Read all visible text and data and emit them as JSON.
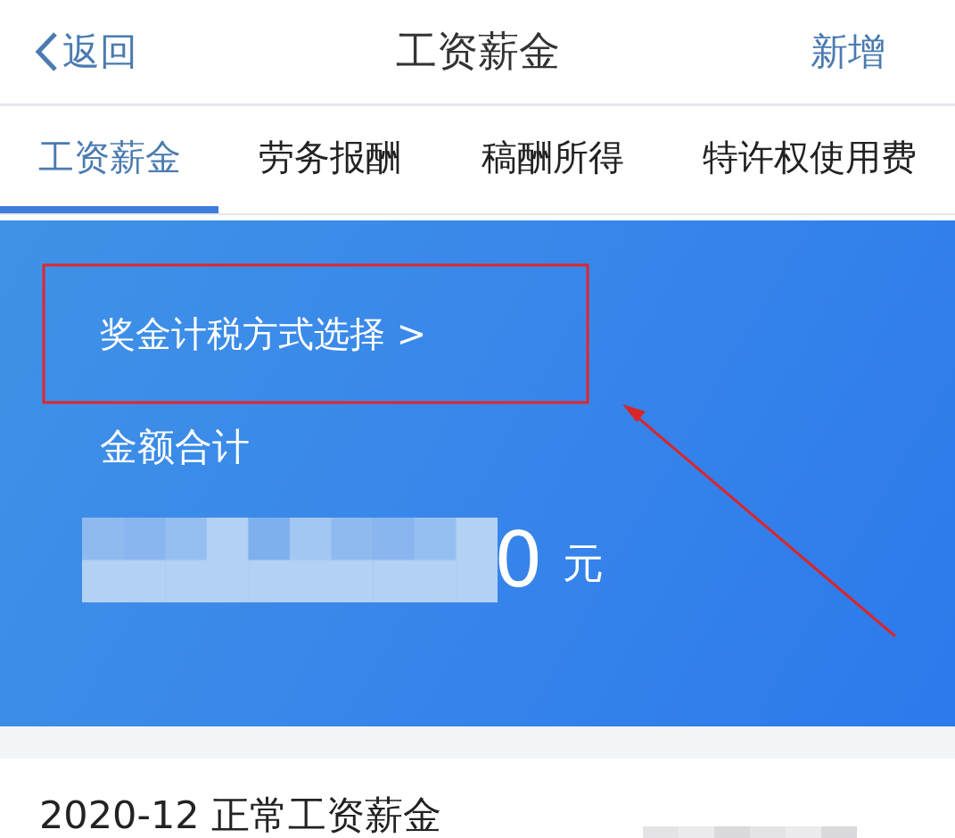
{
  "header": {
    "back": "返回",
    "title": "工资薪金",
    "action": "新增"
  },
  "tabs": [
    {
      "label": "工资薪金",
      "selected": true
    },
    {
      "label": "劳务报酬",
      "selected": false
    },
    {
      "label": "稿酬所得",
      "selected": false
    },
    {
      "label": "特许权使用费",
      "selected": false
    }
  ],
  "summary": {
    "link": "奖金计税方式选择 >",
    "total_label": "金额合计",
    "amount_visible": "0",
    "currency": "元",
    "amount_redacted": true
  },
  "annotations": {
    "highlight_box": true,
    "arrow": true
  },
  "records": [
    {
      "title": "2020-12 正常工资薪金",
      "value_redacted": true
    }
  ]
}
